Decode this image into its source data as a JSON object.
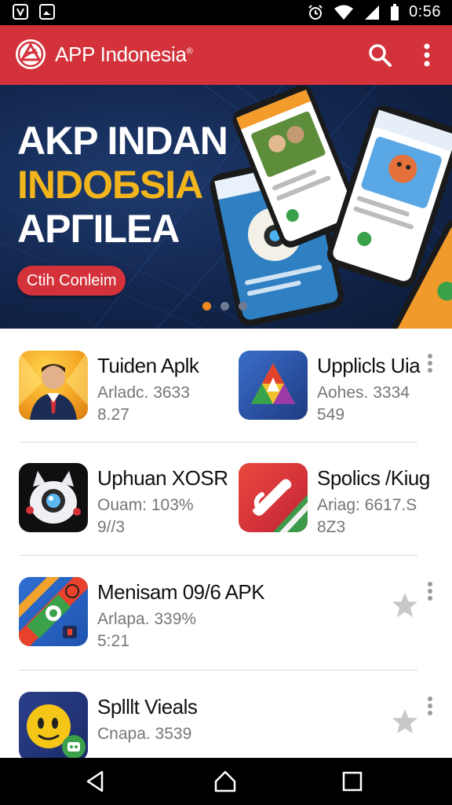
{
  "status_bar": {
    "time": "0:56"
  },
  "app_bar": {
    "title": "APP Indonesia",
    "title_mark": "®"
  },
  "banner": {
    "line1": "AKP INDAN",
    "line2": "INDOБSIA",
    "line3": "APΓILEA",
    "cta_label": "Ctih Conleim",
    "slide_count": 3,
    "active_slide": 1
  },
  "apps": [
    {
      "name": "Tuiden Aplk",
      "meta": "Arladc. 3633",
      "meta2": "8.27",
      "icon": "person-portrait-icon"
    },
    {
      "name": "Upplicls Uia",
      "meta": "Aohes. 3334",
      "meta2": "549",
      "icon": "triangle-logo-icon"
    },
    {
      "name": "Uphuan XOSR",
      "meta": "Ouam: 103%",
      "meta2": "9//3",
      "icon": "camera-robot-icon"
    },
    {
      "name": "Spolics /Kiug",
      "meta": "Ariag: 6617.S",
      "meta2": "8Z3",
      "icon": "phone-handset-icon"
    },
    {
      "name": "Menisam 09/6 APK",
      "meta": "Arlapa. 339%",
      "meta2": "5:21",
      "icon": "game-pieces-icon"
    },
    {
      "name": "Splllt Vieals",
      "meta": "Cnapa. 3539",
      "meta2": "",
      "icon": "smiley-face-icon"
    }
  ],
  "colors": {
    "brand_red": "#d3323a",
    "banner_navy": "#12264d",
    "accent_yellow": "#f3b51c",
    "dot_active": "#ef8a1f"
  },
  "icons": [
    "shield-icon",
    "image-icon",
    "alarm-icon",
    "wifi-icon",
    "signal-icon",
    "battery-icon",
    "search-icon",
    "more-vert-icon",
    "star-icon",
    "back-icon",
    "home-icon",
    "recents-icon"
  ]
}
